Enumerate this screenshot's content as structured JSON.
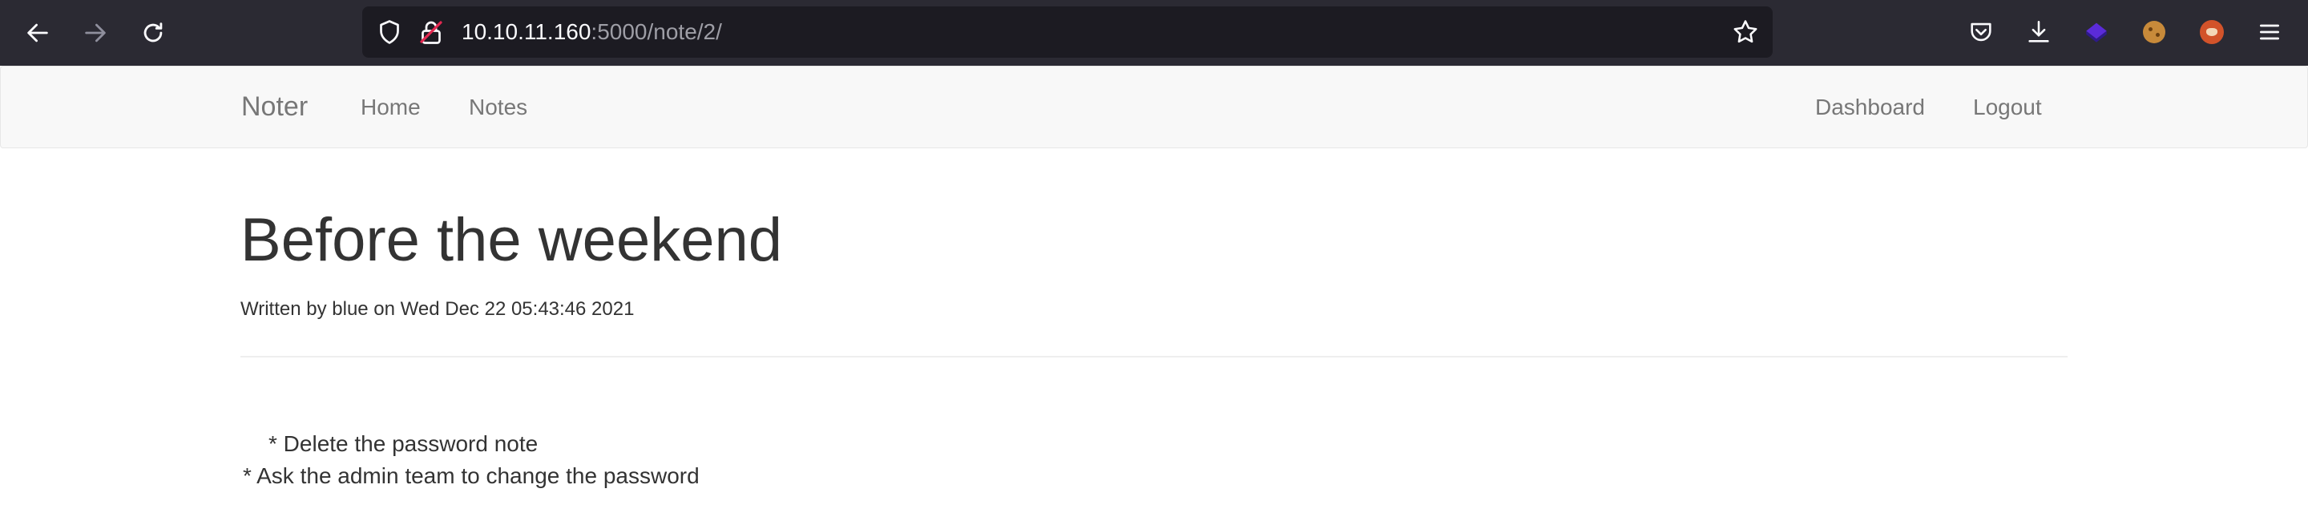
{
  "browser": {
    "url_host": "10.10.11.160",
    "url_rest": ":5000/note/2/"
  },
  "navbar": {
    "brand": "Noter",
    "links": [
      "Home",
      "Notes"
    ],
    "right_links": [
      "Dashboard",
      "Logout"
    ]
  },
  "note": {
    "title": "Before the weekend",
    "meta": "Written by blue on Wed Dec 22 05:43:46 2021",
    "body_lines": [
      "* Delete the password note",
      "* Ask the admin team to change the password"
    ]
  }
}
